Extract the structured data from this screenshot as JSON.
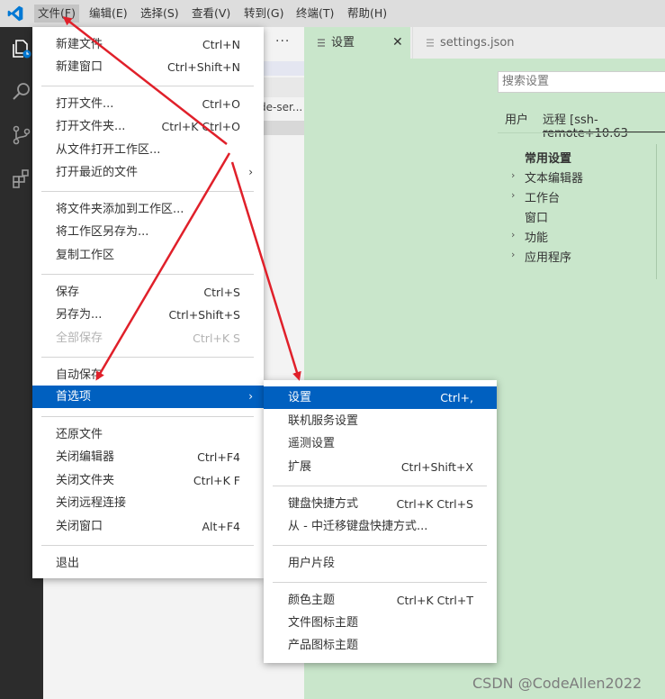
{
  "menubar": {
    "items": [
      "文件(F)",
      "编辑(E)",
      "选择(S)",
      "查看(V)",
      "转到(G)",
      "终端(T)",
      "帮助(H)"
    ]
  },
  "activity_bar": {
    "icons": [
      "explorer-icon",
      "search-icon",
      "source-control-icon",
      "extensions-icon"
    ]
  },
  "side_panel": {
    "more_actions": "···",
    "truncated_item": "de-ser..."
  },
  "editor": {
    "tabs": [
      {
        "label": "设置",
        "close": "✕"
      },
      {
        "label": "settings.json"
      }
    ],
    "search_placeholder": "搜索设置",
    "scope_tabs": [
      "用户",
      "远程 [ssh-remote+10.63"
    ],
    "tree": [
      "常用设置",
      "文本编辑器",
      "工作台",
      "窗口",
      "功能",
      "应用程序"
    ]
  },
  "file_menu": {
    "items": [
      {
        "label": "新建文件",
        "shortcut": "Ctrl+N"
      },
      {
        "label": "新建窗口",
        "shortcut": "Ctrl+Shift+N"
      },
      {
        "label": "打开文件...",
        "shortcut": "Ctrl+O"
      },
      {
        "label": "打开文件夹...",
        "shortcut": "Ctrl+K Ctrl+O"
      },
      {
        "label": "从文件打开工作区...",
        "shortcut": ""
      },
      {
        "label": "打开最近的文件",
        "shortcut": ""
      },
      {
        "label": "将文件夹添加到工作区...",
        "shortcut": ""
      },
      {
        "label": "将工作区另存为...",
        "shortcut": ""
      },
      {
        "label": "复制工作区",
        "shortcut": ""
      },
      {
        "label": "保存",
        "shortcut": "Ctrl+S"
      },
      {
        "label": "另存为...",
        "shortcut": "Ctrl+Shift+S"
      },
      {
        "label": "全部保存",
        "shortcut": "Ctrl+K S"
      },
      {
        "label": "自动保存",
        "shortcut": ""
      },
      {
        "label": "首选项",
        "shortcut": ""
      },
      {
        "label": "还原文件",
        "shortcut": ""
      },
      {
        "label": "关闭编辑器",
        "shortcut": "Ctrl+F4"
      },
      {
        "label": "关闭文件夹",
        "shortcut": "Ctrl+K F"
      },
      {
        "label": "关闭远程连接",
        "shortcut": ""
      },
      {
        "label": "关闭窗口",
        "shortcut": "Alt+F4"
      },
      {
        "label": "退出",
        "shortcut": ""
      }
    ],
    "submenu_arrow": "›"
  },
  "pref_menu": {
    "items": [
      {
        "label": "设置",
        "shortcut": "Ctrl+,"
      },
      {
        "label": "联机服务设置",
        "shortcut": ""
      },
      {
        "label": "遥测设置",
        "shortcut": ""
      },
      {
        "label": "扩展",
        "shortcut": "Ctrl+Shift+X"
      },
      {
        "label": "键盘快捷方式",
        "shortcut": "Ctrl+K Ctrl+S"
      },
      {
        "label": "从 - 中迁移键盘快捷方式...",
        "shortcut": ""
      },
      {
        "label": "用户片段",
        "shortcut": ""
      },
      {
        "label": "颜色主题",
        "shortcut": "Ctrl+K Ctrl+T"
      },
      {
        "label": "文件图标主题",
        "shortcut": ""
      },
      {
        "label": "产品图标主题",
        "shortcut": ""
      }
    ]
  },
  "watermark": "CSDN @CodeAllen2022",
  "colors": {
    "highlight": "#0060c0",
    "editor_bg": "#c9e6cb",
    "annotation_arrow": "#e0202a"
  }
}
